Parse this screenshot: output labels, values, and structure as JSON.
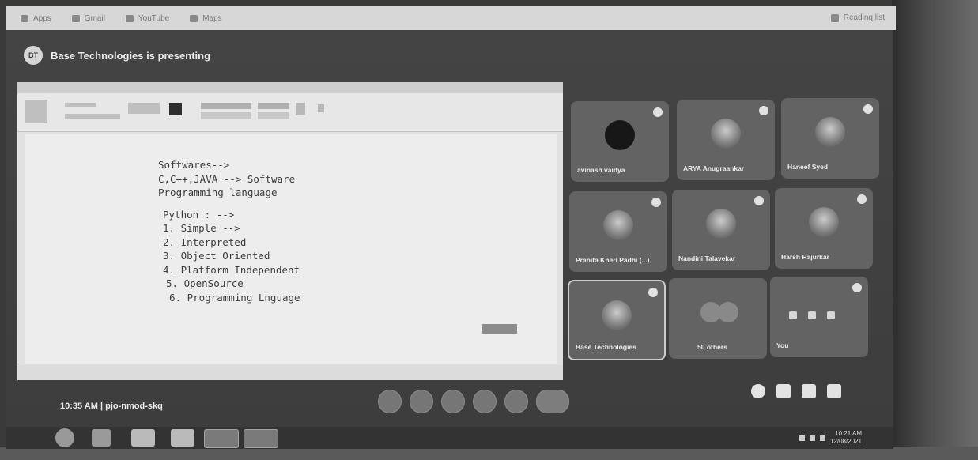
{
  "browser": {
    "bookmarks": [
      {
        "label": "Apps",
        "icon": "apps-grid-icon"
      },
      {
        "label": "Gmail",
        "icon": "gmail-icon"
      },
      {
        "label": "YouTube",
        "icon": "youtube-icon"
      },
      {
        "label": "Maps",
        "icon": "maps-icon"
      }
    ],
    "reading_list": {
      "label": "Reading list",
      "icon": "reading-list-icon"
    }
  },
  "meet": {
    "presenting_banner": {
      "text": "Base Technologies is presenting",
      "avatar_initials": "BT"
    },
    "shared_screen": {
      "lines_block1": [
        "Softwares-->",
        "C,C++,JAVA --> Software",
        "Programming language"
      ],
      "lines_block2": [
        "Python : -->",
        "1. Simple -->",
        "2. Interpreted",
        "3. Object Oriented",
        "4. Platform Independent",
        "5. OpenSource",
        "6. Programming Lnguage"
      ]
    },
    "participants": [
      {
        "name": "avinash vaidya"
      },
      {
        "name": "ARYA Anugraankar"
      },
      {
        "name": "Haneef Syed"
      },
      {
        "name": "Pranita Kheri Padhi (...)"
      },
      {
        "name": "Nandini Talavekar"
      },
      {
        "name": "Harsh Rajurkar"
      },
      {
        "name": "Base Technologies"
      },
      {
        "name": "50 others"
      },
      {
        "name": "You"
      }
    ],
    "meeting_info": {
      "time": "10:35 AM",
      "separator": "|",
      "code": "pjo-nmod-skq"
    },
    "controls": [
      "mic-icon",
      "camera-icon",
      "captions-icon",
      "present-icon",
      "more-options-icon",
      "end-call-icon"
    ],
    "side_controls": [
      "info-icon",
      "people-icon",
      "chat-icon",
      "activities-icon"
    ]
  },
  "taskbar": {
    "apps": [
      "start-icon",
      "ie-icon",
      "explorer-icon",
      "media-icon",
      "chrome-icon",
      "notepad-icon"
    ],
    "clock": {
      "time": "10:21 AM",
      "date": "12/08/2021"
    }
  }
}
